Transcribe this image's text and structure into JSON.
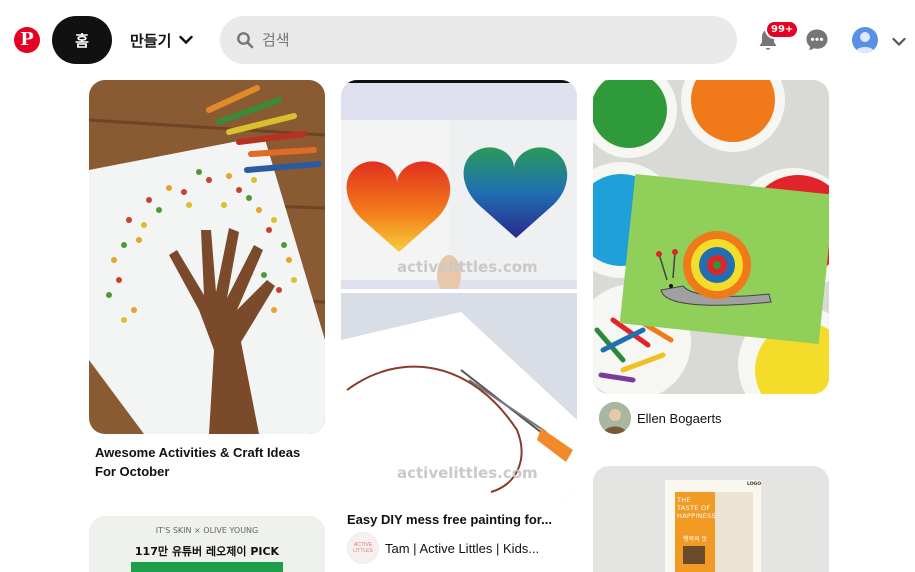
{
  "header": {
    "logo_letter": "P",
    "home_label": "홈",
    "create_label": "만들기",
    "search_placeholder": "검색",
    "notification_badge": "99+"
  },
  "pins": [
    {
      "title": "Awesome Activities & Craft Ideas For October"
    },
    {
      "title": "Easy DIY mess free painting for...",
      "watermark": "activelittles.com",
      "creator": "Tam | Active Littles | Kids...",
      "creator_avatar_text": "ACTIVE LITTLES"
    },
    {
      "creator": "Ellen Bogaerts"
    },
    {
      "banner_brand": "IT'S SKIN × OLIVE YOUNG",
      "banner_text": "117만 유튜버 레오제이 PICK"
    },
    {
      "book_title": "THE TASTE OF HAPPINESS",
      "book_sub": "행복의 맛",
      "book_brand": "LOGO"
    }
  ],
  "colors": {
    "brand": "#e60023",
    "search_bg": "#e9e9e9"
  }
}
